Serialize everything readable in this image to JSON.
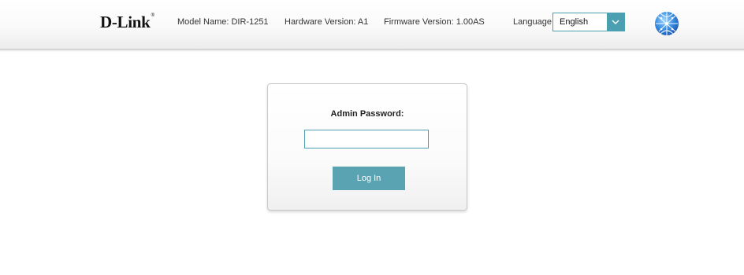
{
  "header": {
    "logo_text": "D-Link",
    "logo_mark": "®",
    "model_name": "Model Name: DIR-1251",
    "hardware_version": "Hardware Version: A1",
    "firmware_version": "Firmware Version: 1.00AS",
    "language_label": "Language:",
    "language_selected": "English",
    "globe_icon": "globe-icon"
  },
  "login": {
    "password_label": "Admin Password:",
    "password_value": "",
    "password_placeholder": "",
    "login_button": "Log In"
  },
  "colors": {
    "accent": "#4aa0b0",
    "button": "#5aa3b2"
  }
}
